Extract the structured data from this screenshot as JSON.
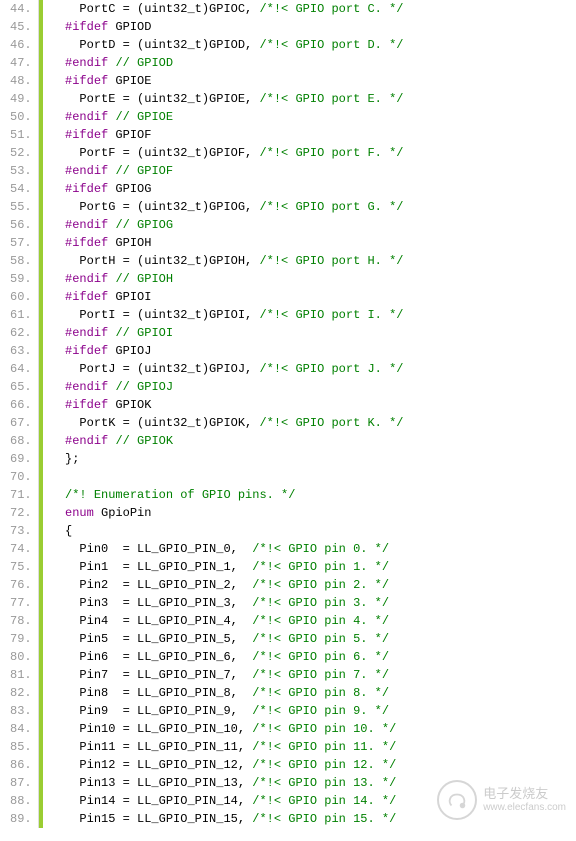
{
  "lines": [
    {
      "n": 44,
      "indent": 2,
      "tokens": [
        {
          "t": "PortC = (",
          "c": "punct"
        },
        {
          "t": "uint32_t",
          "c": "type"
        },
        {
          "t": ")GPIOC, ",
          "c": "punct"
        },
        {
          "t": "/*!< GPIO port C. */",
          "c": "comment"
        }
      ]
    },
    {
      "n": 45,
      "indent": 1,
      "tokens": [
        {
          "t": "#ifdef",
          "c": "pp"
        },
        {
          "t": " GPIOD",
          "c": "ident"
        }
      ]
    },
    {
      "n": 46,
      "indent": 2,
      "tokens": [
        {
          "t": "PortD = (",
          "c": "punct"
        },
        {
          "t": "uint32_t",
          "c": "type"
        },
        {
          "t": ")GPIOD, ",
          "c": "punct"
        },
        {
          "t": "/*!< GPIO port D. */",
          "c": "comment"
        }
      ]
    },
    {
      "n": 47,
      "indent": 1,
      "tokens": [
        {
          "t": "#endif",
          "c": "pp"
        },
        {
          "t": " ",
          "c": "punct"
        },
        {
          "t": "// GPIOD",
          "c": "comment"
        }
      ]
    },
    {
      "n": 48,
      "indent": 1,
      "tokens": [
        {
          "t": "#ifdef",
          "c": "pp"
        },
        {
          "t": " GPIOE",
          "c": "ident"
        }
      ]
    },
    {
      "n": 49,
      "indent": 2,
      "tokens": [
        {
          "t": "PortE = (",
          "c": "punct"
        },
        {
          "t": "uint32_t",
          "c": "type"
        },
        {
          "t": ")GPIOE, ",
          "c": "punct"
        },
        {
          "t": "/*!< GPIO port E. */",
          "c": "comment"
        }
      ]
    },
    {
      "n": 50,
      "indent": 1,
      "tokens": [
        {
          "t": "#endif",
          "c": "pp"
        },
        {
          "t": " ",
          "c": "punct"
        },
        {
          "t": "// GPIOE",
          "c": "comment"
        }
      ]
    },
    {
      "n": 51,
      "indent": 1,
      "tokens": [
        {
          "t": "#ifdef",
          "c": "pp"
        },
        {
          "t": " GPIOF",
          "c": "ident"
        }
      ]
    },
    {
      "n": 52,
      "indent": 2,
      "tokens": [
        {
          "t": "PortF = (",
          "c": "punct"
        },
        {
          "t": "uint32_t",
          "c": "type"
        },
        {
          "t": ")GPIOF, ",
          "c": "punct"
        },
        {
          "t": "/*!< GPIO port F. */",
          "c": "comment"
        }
      ]
    },
    {
      "n": 53,
      "indent": 1,
      "tokens": [
        {
          "t": "#endif",
          "c": "pp"
        },
        {
          "t": " ",
          "c": "punct"
        },
        {
          "t": "// GPIOF",
          "c": "comment"
        }
      ]
    },
    {
      "n": 54,
      "indent": 1,
      "tokens": [
        {
          "t": "#ifdef",
          "c": "pp"
        },
        {
          "t": " GPIOG",
          "c": "ident"
        }
      ]
    },
    {
      "n": 55,
      "indent": 2,
      "tokens": [
        {
          "t": "PortG = (",
          "c": "punct"
        },
        {
          "t": "uint32_t",
          "c": "type"
        },
        {
          "t": ")GPIOG, ",
          "c": "punct"
        },
        {
          "t": "/*!< GPIO port G. */",
          "c": "comment"
        }
      ]
    },
    {
      "n": 56,
      "indent": 1,
      "tokens": [
        {
          "t": "#endif",
          "c": "pp"
        },
        {
          "t": " ",
          "c": "punct"
        },
        {
          "t": "// GPIOG",
          "c": "comment"
        }
      ]
    },
    {
      "n": 57,
      "indent": 1,
      "tokens": [
        {
          "t": "#ifdef",
          "c": "pp"
        },
        {
          "t": " GPIOH",
          "c": "ident"
        }
      ]
    },
    {
      "n": 58,
      "indent": 2,
      "tokens": [
        {
          "t": "PortH = (",
          "c": "punct"
        },
        {
          "t": "uint32_t",
          "c": "type"
        },
        {
          "t": ")GPIOH, ",
          "c": "punct"
        },
        {
          "t": "/*!< GPIO port H. */",
          "c": "comment"
        }
      ]
    },
    {
      "n": 59,
      "indent": 1,
      "tokens": [
        {
          "t": "#endif",
          "c": "pp"
        },
        {
          "t": " ",
          "c": "punct"
        },
        {
          "t": "// GPIOH",
          "c": "comment"
        }
      ]
    },
    {
      "n": 60,
      "indent": 1,
      "tokens": [
        {
          "t": "#ifdef",
          "c": "pp"
        },
        {
          "t": " GPIOI",
          "c": "ident"
        }
      ]
    },
    {
      "n": 61,
      "indent": 2,
      "tokens": [
        {
          "t": "PortI = (",
          "c": "punct"
        },
        {
          "t": "uint32_t",
          "c": "type"
        },
        {
          "t": ")GPIOI, ",
          "c": "punct"
        },
        {
          "t": "/*!< GPIO port I. */",
          "c": "comment"
        }
      ]
    },
    {
      "n": 62,
      "indent": 1,
      "tokens": [
        {
          "t": "#endif",
          "c": "pp"
        },
        {
          "t": " ",
          "c": "punct"
        },
        {
          "t": "// GPIOI",
          "c": "comment"
        }
      ]
    },
    {
      "n": 63,
      "indent": 1,
      "tokens": [
        {
          "t": "#ifdef",
          "c": "pp"
        },
        {
          "t": " GPIOJ",
          "c": "ident"
        }
      ]
    },
    {
      "n": 64,
      "indent": 2,
      "tokens": [
        {
          "t": "PortJ = (",
          "c": "punct"
        },
        {
          "t": "uint32_t",
          "c": "type"
        },
        {
          "t": ")GPIOJ, ",
          "c": "punct"
        },
        {
          "t": "/*!< GPIO port J. */",
          "c": "comment"
        }
      ]
    },
    {
      "n": 65,
      "indent": 1,
      "tokens": [
        {
          "t": "#endif",
          "c": "pp"
        },
        {
          "t": " ",
          "c": "punct"
        },
        {
          "t": "// GPIOJ",
          "c": "comment"
        }
      ]
    },
    {
      "n": 66,
      "indent": 1,
      "tokens": [
        {
          "t": "#ifdef",
          "c": "pp"
        },
        {
          "t": " GPIOK",
          "c": "ident"
        }
      ]
    },
    {
      "n": 67,
      "indent": 2,
      "tokens": [
        {
          "t": "PortK = (",
          "c": "punct"
        },
        {
          "t": "uint32_t",
          "c": "type"
        },
        {
          "t": ")GPIOK, ",
          "c": "punct"
        },
        {
          "t": "/*!< GPIO port K. */",
          "c": "comment"
        }
      ]
    },
    {
      "n": 68,
      "indent": 1,
      "tokens": [
        {
          "t": "#endif",
          "c": "pp"
        },
        {
          "t": " ",
          "c": "punct"
        },
        {
          "t": "// GPIOK",
          "c": "comment"
        }
      ]
    },
    {
      "n": 69,
      "indent": 1,
      "tokens": [
        {
          "t": "};",
          "c": "punct"
        }
      ]
    },
    {
      "n": 70,
      "indent": 0,
      "tokens": []
    },
    {
      "n": 71,
      "indent": 1,
      "tokens": [
        {
          "t": "/*! Enumeration of GPIO pins. */",
          "c": "comment"
        }
      ]
    },
    {
      "n": 72,
      "indent": 1,
      "tokens": [
        {
          "t": "enum",
          "c": "keyword"
        },
        {
          "t": " GpioPin",
          "c": "ident"
        }
      ]
    },
    {
      "n": 73,
      "indent": 1,
      "tokens": [
        {
          "t": "{",
          "c": "punct"
        }
      ]
    },
    {
      "n": 74,
      "indent": 2,
      "tokens": [
        {
          "t": "Pin0  = LL_GPIO_PIN_0,  ",
          "c": "punct"
        },
        {
          "t": "/*!< GPIO pin 0. */",
          "c": "comment"
        }
      ]
    },
    {
      "n": 75,
      "indent": 2,
      "tokens": [
        {
          "t": "Pin1  = LL_GPIO_PIN_1,  ",
          "c": "punct"
        },
        {
          "t": "/*!< GPIO pin 1. */",
          "c": "comment"
        }
      ]
    },
    {
      "n": 76,
      "indent": 2,
      "tokens": [
        {
          "t": "Pin2  = LL_GPIO_PIN_2,  ",
          "c": "punct"
        },
        {
          "t": "/*!< GPIO pin 2. */",
          "c": "comment"
        }
      ]
    },
    {
      "n": 77,
      "indent": 2,
      "tokens": [
        {
          "t": "Pin3  = LL_GPIO_PIN_3,  ",
          "c": "punct"
        },
        {
          "t": "/*!< GPIO pin 3. */",
          "c": "comment"
        }
      ]
    },
    {
      "n": 78,
      "indent": 2,
      "tokens": [
        {
          "t": "Pin4  = LL_GPIO_PIN_4,  ",
          "c": "punct"
        },
        {
          "t": "/*!< GPIO pin 4. */",
          "c": "comment"
        }
      ]
    },
    {
      "n": 79,
      "indent": 2,
      "tokens": [
        {
          "t": "Pin5  = LL_GPIO_PIN_5,  ",
          "c": "punct"
        },
        {
          "t": "/*!< GPIO pin 5. */",
          "c": "comment"
        }
      ]
    },
    {
      "n": 80,
      "indent": 2,
      "tokens": [
        {
          "t": "Pin6  = LL_GPIO_PIN_6,  ",
          "c": "punct"
        },
        {
          "t": "/*!< GPIO pin 6. */",
          "c": "comment"
        }
      ]
    },
    {
      "n": 81,
      "indent": 2,
      "tokens": [
        {
          "t": "Pin7  = LL_GPIO_PIN_7,  ",
          "c": "punct"
        },
        {
          "t": "/*!< GPIO pin 7. */",
          "c": "comment"
        }
      ]
    },
    {
      "n": 82,
      "indent": 2,
      "tokens": [
        {
          "t": "Pin8  = LL_GPIO_PIN_8,  ",
          "c": "punct"
        },
        {
          "t": "/*!< GPIO pin 8. */",
          "c": "comment"
        }
      ]
    },
    {
      "n": 83,
      "indent": 2,
      "tokens": [
        {
          "t": "Pin9  = LL_GPIO_PIN_9,  ",
          "c": "punct"
        },
        {
          "t": "/*!< GPIO pin 9. */",
          "c": "comment"
        }
      ]
    },
    {
      "n": 84,
      "indent": 2,
      "tokens": [
        {
          "t": "Pin10 = LL_GPIO_PIN_10, ",
          "c": "punct"
        },
        {
          "t": "/*!< GPIO pin 10. */",
          "c": "comment"
        }
      ]
    },
    {
      "n": 85,
      "indent": 2,
      "tokens": [
        {
          "t": "Pin11 = LL_GPIO_PIN_11, ",
          "c": "punct"
        },
        {
          "t": "/*!< GPIO pin 11. */",
          "c": "comment"
        }
      ]
    },
    {
      "n": 86,
      "indent": 2,
      "tokens": [
        {
          "t": "Pin12 = LL_GPIO_PIN_12, ",
          "c": "punct"
        },
        {
          "t": "/*!< GPIO pin 12. */",
          "c": "comment"
        }
      ]
    },
    {
      "n": 87,
      "indent": 2,
      "tokens": [
        {
          "t": "Pin13 = LL_GPIO_PIN_13, ",
          "c": "punct"
        },
        {
          "t": "/*!< GPIO pin 13. */",
          "c": "comment"
        }
      ]
    },
    {
      "n": 88,
      "indent": 2,
      "tokens": [
        {
          "t": "Pin14 = LL_GPIO_PIN_14, ",
          "c": "punct"
        },
        {
          "t": "/*!< GPIO pin 14. */",
          "c": "comment"
        }
      ]
    },
    {
      "n": 89,
      "indent": 2,
      "tokens": [
        {
          "t": "Pin15 = LL_GPIO_PIN_15, ",
          "c": "punct"
        },
        {
          "t": "/*!< GPIO pin 15. */",
          "c": "comment"
        }
      ]
    }
  ],
  "watermark": {
    "cn": "电子发烧友",
    "url": "www.elecfans.com"
  }
}
